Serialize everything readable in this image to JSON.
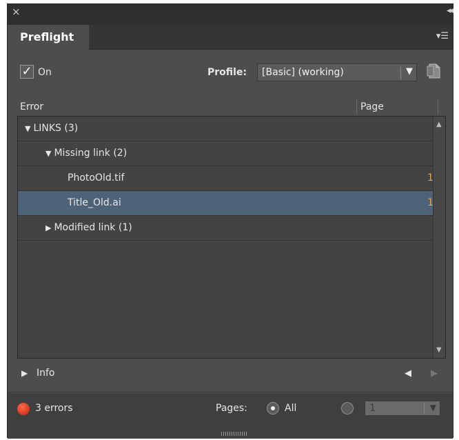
{
  "panel": {
    "close_icon": "×",
    "collapse_icon": "◂◂",
    "tab_title": "Preflight",
    "menu_icon": "▾☰"
  },
  "controls": {
    "on_checked": true,
    "on_label": "On",
    "profile_label": "Profile:",
    "profile_value": "[Basic] (working)",
    "profile_arrow": "▼"
  },
  "columns": {
    "error": "Error",
    "page": "Page"
  },
  "tree": {
    "rows": [
      {
        "label": "LINKS (3)",
        "indent": 0,
        "triangle": "▼",
        "page": ""
      },
      {
        "label": "Missing link (2)",
        "indent": 1,
        "triangle": "▼",
        "page": ""
      },
      {
        "label": "PhotoOld.tif",
        "indent": 2,
        "triangle": "",
        "page": "1"
      },
      {
        "label": "Title_Old.ai",
        "indent": 2,
        "triangle": "",
        "page": "1",
        "selected": true
      },
      {
        "label": "Modified link (1)",
        "indent": 1,
        "triangle": "▶",
        "page": ""
      }
    ]
  },
  "info": {
    "triangle": "▶",
    "label": "Info",
    "prev": "◀",
    "next": "▶"
  },
  "status": {
    "error_count": "3 errors",
    "pages_label": "Pages:",
    "all_label": "All",
    "range_value": "1",
    "range_arrow": "▼"
  },
  "colors": {
    "panel_bg": "#4d4d4d",
    "selected_row": "#4f6378",
    "page_number": "#e1a65a",
    "error_dot": "#d9301a"
  }
}
